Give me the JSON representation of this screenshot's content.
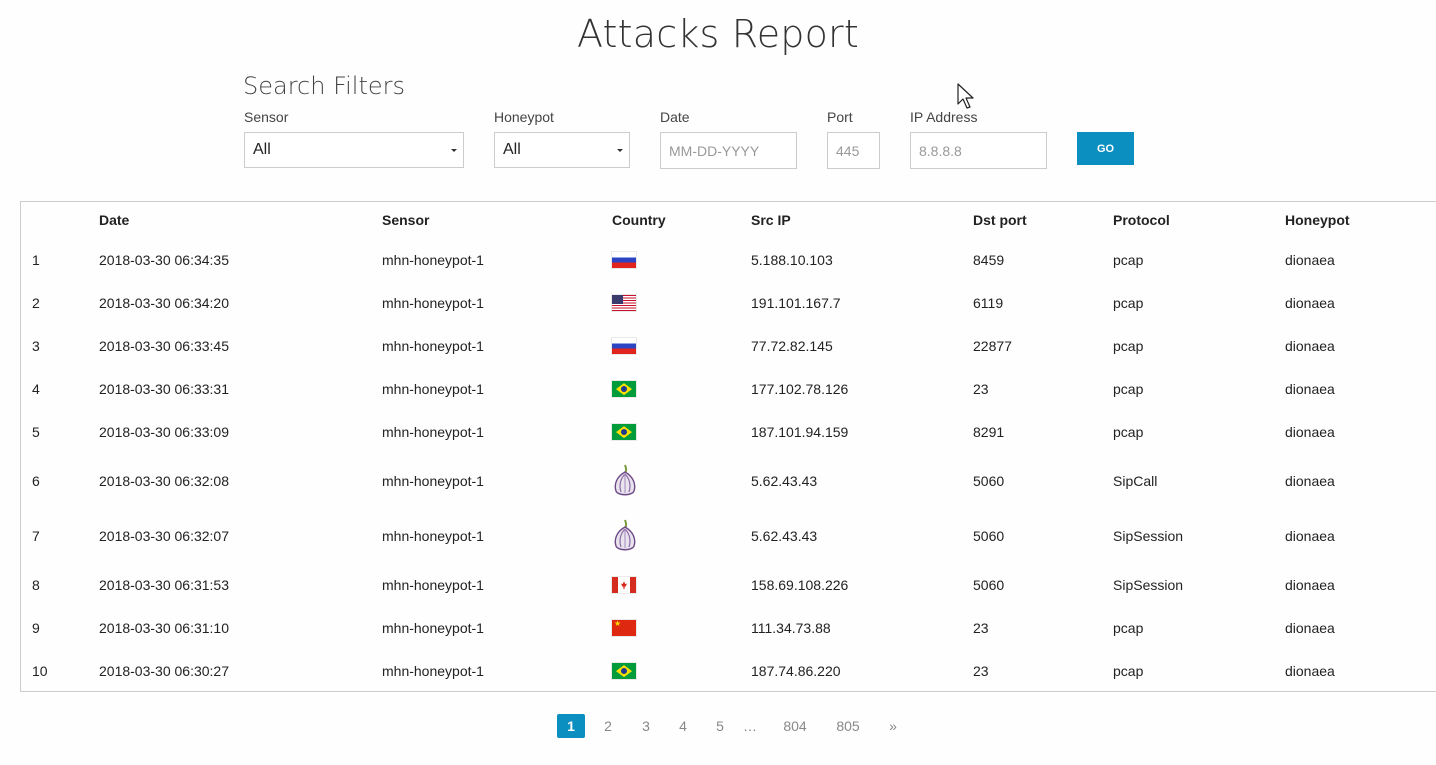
{
  "page": {
    "title": "Attacks Report"
  },
  "filters": {
    "heading": "Search Filters",
    "sensor": {
      "label": "Sensor",
      "value": "All"
    },
    "honeypot": {
      "label": "Honeypot",
      "value": "All"
    },
    "date": {
      "label": "Date",
      "placeholder": "MM-DD-YYYY"
    },
    "port": {
      "label": "Port",
      "placeholder": "445"
    },
    "ip": {
      "label": "IP Address",
      "placeholder": "8.8.8.8"
    },
    "go_label": "GO"
  },
  "table": {
    "headers": [
      "",
      "Date",
      "Sensor",
      "Country",
      "Src IP",
      "Dst port",
      "Protocol",
      "Honeypot"
    ],
    "rows": [
      {
        "num": "1",
        "date": "2018-03-30 06:34:35",
        "sensor": "mhn-honeypot-1",
        "country": "ru",
        "src_ip": "5.188.10.103",
        "dst_port": "8459",
        "protocol": "pcap",
        "honeypot": "dionaea"
      },
      {
        "num": "2",
        "date": "2018-03-30 06:34:20",
        "sensor": "mhn-honeypot-1",
        "country": "us",
        "src_ip": "191.101.167.7",
        "dst_port": "6119",
        "protocol": "pcap",
        "honeypot": "dionaea"
      },
      {
        "num": "3",
        "date": "2018-03-30 06:33:45",
        "sensor": "mhn-honeypot-1",
        "country": "ru",
        "src_ip": "77.72.82.145",
        "dst_port": "22877",
        "protocol": "pcap",
        "honeypot": "dionaea"
      },
      {
        "num": "4",
        "date": "2018-03-30 06:33:31",
        "sensor": "mhn-honeypot-1",
        "country": "br",
        "src_ip": "177.102.78.126",
        "dst_port": "23",
        "protocol": "pcap",
        "honeypot": "dionaea"
      },
      {
        "num": "5",
        "date": "2018-03-30 06:33:09",
        "sensor": "mhn-honeypot-1",
        "country": "br",
        "src_ip": "187.101.94.159",
        "dst_port": "8291",
        "protocol": "pcap",
        "honeypot": "dionaea"
      },
      {
        "num": "6",
        "date": "2018-03-30 06:32:08",
        "sensor": "mhn-honeypot-1",
        "country": "tor",
        "src_ip": "5.62.43.43",
        "dst_port": "5060",
        "protocol": "SipCall",
        "honeypot": "dionaea"
      },
      {
        "num": "7",
        "date": "2018-03-30 06:32:07",
        "sensor": "mhn-honeypot-1",
        "country": "tor",
        "src_ip": "5.62.43.43",
        "dst_port": "5060",
        "protocol": "SipSession",
        "honeypot": "dionaea"
      },
      {
        "num": "8",
        "date": "2018-03-30 06:31:53",
        "sensor": "mhn-honeypot-1",
        "country": "ca",
        "src_ip": "158.69.108.226",
        "dst_port": "5060",
        "protocol": "SipSession",
        "honeypot": "dionaea"
      },
      {
        "num": "9",
        "date": "2018-03-30 06:31:10",
        "sensor": "mhn-honeypot-1",
        "country": "cn",
        "src_ip": "111.34.73.88",
        "dst_port": "23",
        "protocol": "pcap",
        "honeypot": "dionaea"
      },
      {
        "num": "10",
        "date": "2018-03-30 06:30:27",
        "sensor": "mhn-honeypot-1",
        "country": "br",
        "src_ip": "187.74.86.220",
        "dst_port": "23",
        "protocol": "pcap",
        "honeypot": "dionaea"
      }
    ]
  },
  "pagination": {
    "pages": [
      "1",
      "2",
      "3",
      "4",
      "5",
      "…",
      "804",
      "805",
      "»"
    ],
    "active": "1"
  },
  "colors": {
    "accent": "#0b8fc0"
  }
}
